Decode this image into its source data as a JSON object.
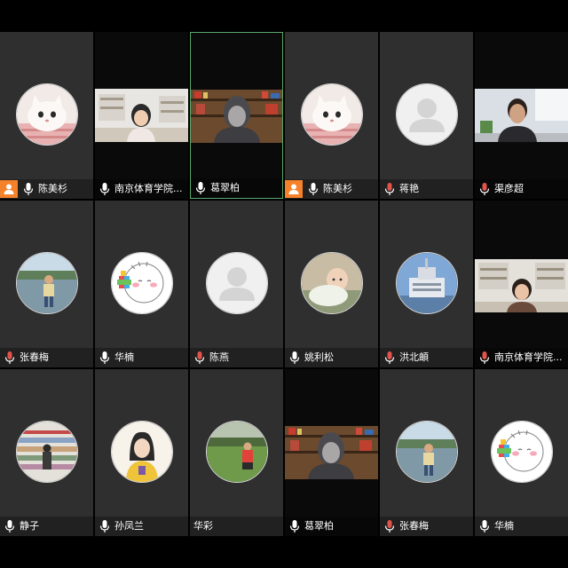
{
  "participants": [
    {
      "name": "陈美杉",
      "host": true,
      "media": "cat-photo-avatar",
      "mic": "active"
    },
    {
      "name": "南京体育学院...",
      "host": false,
      "media": "video-girl-office",
      "mic": "active"
    },
    {
      "name": "葛翠柏",
      "host": false,
      "media": "video-person-bookshelf",
      "mic": "active",
      "speaking": true
    },
    {
      "name": "陈美杉",
      "host": true,
      "media": "cat-photo-avatar",
      "mic": "active"
    },
    {
      "name": "蒋艳",
      "host": false,
      "media": "default-avatar",
      "mic": "muted"
    },
    {
      "name": "渠彦超",
      "host": false,
      "media": "video-man-room",
      "mic": "muted"
    },
    {
      "name": "张春梅",
      "host": false,
      "media": "child-lake-avatar",
      "mic": "muted"
    },
    {
      "name": "华楠",
      "host": false,
      "media": "cartoon-face-avatar",
      "mic": "active"
    },
    {
      "name": "陈燕",
      "host": false,
      "media": "default-avatar",
      "mic": "muted"
    },
    {
      "name": "姚利松",
      "host": false,
      "media": "baby-photo-avatar",
      "mic": "active"
    },
    {
      "name": "洪北頔",
      "host": false,
      "media": "ship-photo-avatar",
      "mic": "muted"
    },
    {
      "name": "南京体育学院...",
      "host": false,
      "media": "video-woman-office",
      "mic": "muted"
    },
    {
      "name": "静子",
      "host": false,
      "media": "library-photo-avatar",
      "mic": "active"
    },
    {
      "name": "孙凤兰",
      "host": false,
      "media": "cartoon-girl-avatar",
      "mic": "active"
    },
    {
      "name": "华彩",
      "host": false,
      "media": "lawn-photo-avatar",
      "mic": "none"
    },
    {
      "name": "葛翠柏",
      "host": false,
      "media": "video-person-bookshelf",
      "mic": "active"
    },
    {
      "name": "张春梅",
      "host": false,
      "media": "child-lake-avatar",
      "mic": "muted"
    },
    {
      "name": "华楠",
      "host": false,
      "media": "cartoon-face-avatar",
      "mic": "active"
    }
  ],
  "colors": {
    "tile_bg": "#2f2f2f",
    "page_bg": "#000000",
    "host_badge": "#f5822a",
    "mic_muted": "#e0544b",
    "mic_active": "#ffffff",
    "speaking_border": "#5aa86a"
  }
}
